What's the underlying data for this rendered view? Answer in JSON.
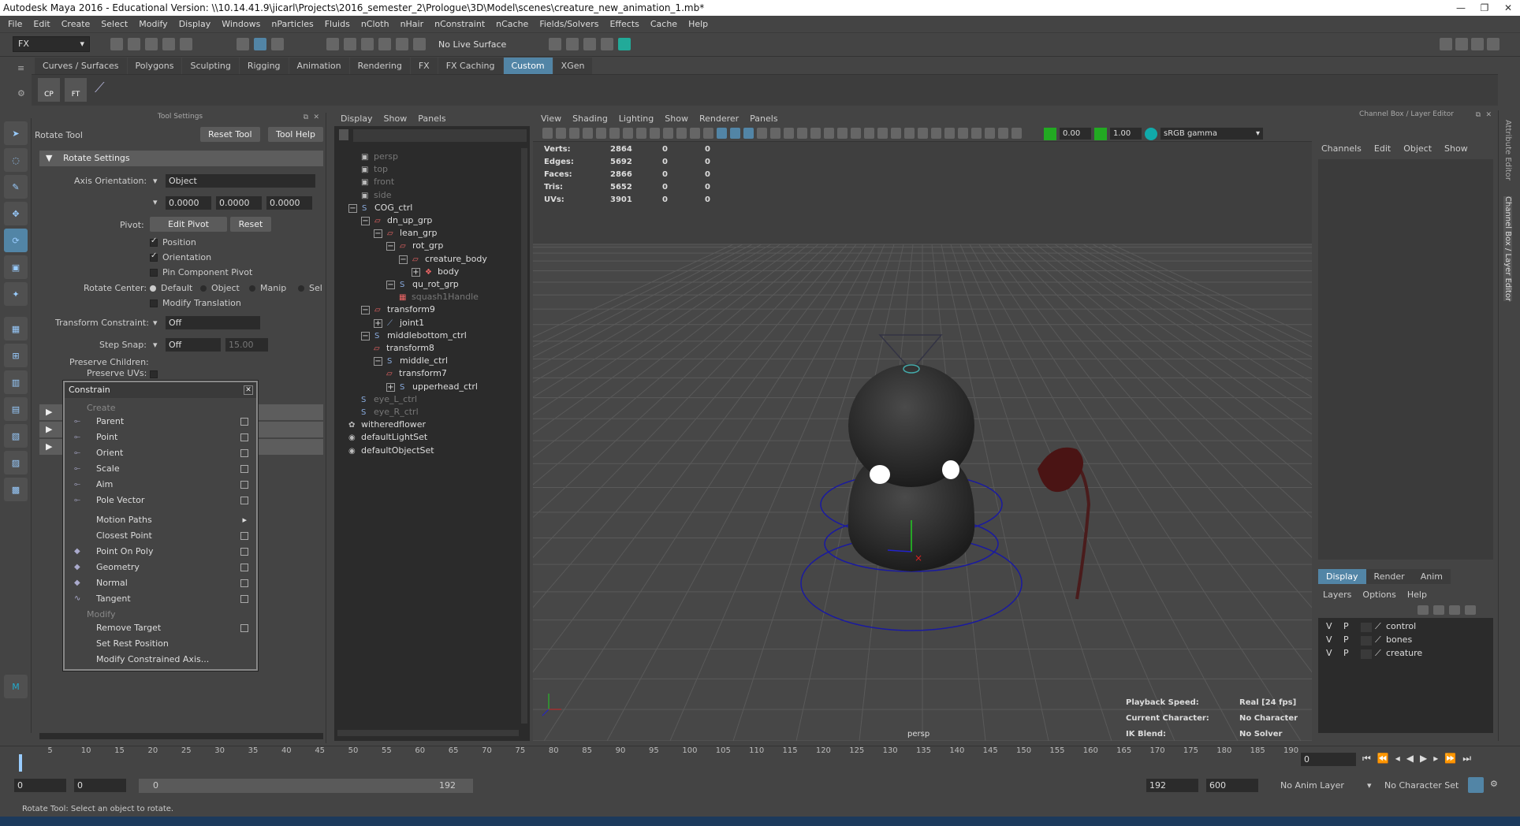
{
  "title": "Autodesk Maya 2016 - Educational Version: \\\\10.14.41.9\\jicarl\\Projects\\2016_semester_2\\Prologue\\3D\\Model\\scenes\\creature_new_animation_1.mb*",
  "menus": [
    "File",
    "Edit",
    "Create",
    "Select",
    "Modify",
    "Display",
    "Windows",
    "nParticles",
    "Fluids",
    "nCloth",
    "nHair",
    "nConstraint",
    "nCache",
    "Fields/Solvers",
    "Effects",
    "Cache",
    "Help"
  ],
  "status": {
    "menuset": "FX",
    "live_surface": "No Live Surface"
  },
  "shelf_tabs": [
    "Curves / Surfaces",
    "Polygons",
    "Sculpting",
    "Rigging",
    "Animation",
    "Rendering",
    "FX",
    "FX Caching",
    "Custom",
    "XGen"
  ],
  "shelf_buttons": [
    "CP",
    "FT"
  ],
  "tool_settings": {
    "header": "Tool Settings",
    "tool_name": "Rotate Tool",
    "reset_tool": "Reset Tool",
    "tool_help": "Tool Help",
    "section": "Rotate Settings",
    "axis_orientation_label": "Axis Orientation:",
    "axis_orientation_value": "Object",
    "axis_values": [
      "0.0000",
      "0.0000",
      "0.0000"
    ],
    "pivot_label": "Pivot:",
    "edit_pivot": "Edit Pivot",
    "reset": "Reset",
    "position": "Position",
    "orientation": "Orientation",
    "pin_component_pivot": "Pin Component Pivot",
    "rotate_center_label": "Rotate Center:",
    "rotate_center_options": [
      "Default",
      "Object",
      "Manip",
      "Sel"
    ],
    "modify_translation": "Modify Translation",
    "transform_constraint_label": "Transform Constraint:",
    "transform_constraint_value": "Off",
    "step_snap_label": "Step Snap:",
    "step_snap_value": "Off",
    "step_snap_amount": "15.00",
    "preserve_children": "Preserve Children:",
    "preserve_uvs": "Preserve UVs:"
  },
  "constrain_menu": {
    "title": "Constrain",
    "create_label": "Create",
    "modify_label": "Modify",
    "create_items": [
      "Parent",
      "Point",
      "Orient",
      "Scale",
      "Aim",
      "Pole Vector"
    ],
    "other_items": [
      "Motion Paths",
      "Closest Point",
      "Point On Poly",
      "Geometry",
      "Normal",
      "Tangent"
    ],
    "modify_items": [
      "Remove Target",
      "Set Rest Position",
      "Modify Constrained Axis..."
    ]
  },
  "outliner": {
    "menus": [
      "Display",
      "Show",
      "Panels"
    ],
    "items": [
      {
        "label": "persp",
        "dim": true
      },
      {
        "label": "top",
        "dim": true
      },
      {
        "label": "front",
        "dim": true
      },
      {
        "label": "side",
        "dim": true
      },
      {
        "label": "COG_ctrl",
        "dim": false
      },
      {
        "label": "dn_up_grp",
        "dim": false
      },
      {
        "label": "lean_grp",
        "dim": false
      },
      {
        "label": "rot_grp",
        "dim": false
      },
      {
        "label": "creature_body",
        "dim": false
      },
      {
        "label": "body",
        "dim": false
      },
      {
        "label": "qu_rot_grp",
        "dim": false
      },
      {
        "label": "squash1Handle",
        "dim": true
      },
      {
        "label": "transform9",
        "dim": false
      },
      {
        "label": "joint1",
        "dim": false
      },
      {
        "label": "middlebottom_ctrl",
        "dim": false
      },
      {
        "label": "transform8",
        "dim": false
      },
      {
        "label": "middle_ctrl",
        "dim": false
      },
      {
        "label": "transform7",
        "dim": false
      },
      {
        "label": "upperhead_ctrl",
        "dim": false
      },
      {
        "label": "eye_L_ctrl",
        "dim": true
      },
      {
        "label": "eye_R_ctrl",
        "dim": true
      },
      {
        "label": "witheredflower",
        "dim": false
      },
      {
        "label": "defaultLightSet",
        "dim": false
      },
      {
        "label": "defaultObjectSet",
        "dim": false
      }
    ]
  },
  "viewport": {
    "menus": [
      "View",
      "Shading",
      "Lighting",
      "Show",
      "Renderer",
      "Panels"
    ],
    "exposure": "0.00",
    "gamma": "1.00",
    "colorspace": "sRGB gamma",
    "stats": [
      {
        "label": "Verts:",
        "v1": "2864",
        "v2": "0",
        "v3": "0"
      },
      {
        "label": "Edges:",
        "v1": "5692",
        "v2": "0",
        "v3": "0"
      },
      {
        "label": "Faces:",
        "v1": "2866",
        "v2": "0",
        "v3": "0"
      },
      {
        "label": "Tris:",
        "v1": "5652",
        "v2": "0",
        "v3": "0"
      },
      {
        "label": "UVs:",
        "v1": "3901",
        "v2": "0",
        "v3": "0"
      }
    ],
    "camera": "persp",
    "playback_speed_label": "Playback Speed:",
    "playback_speed": "Real [24 fps]",
    "current_character_label": "Current Character:",
    "current_character": "No Character",
    "ik_blend_label": "IK Blend:",
    "ik_blend": "No Solver"
  },
  "channel_box": {
    "header": "Channel Box / Layer Editor",
    "menus": [
      "Channels",
      "Edit",
      "Object",
      "Show"
    ],
    "layer_tabs": [
      "Display",
      "Render",
      "Anim"
    ],
    "layer_menus": [
      "Layers",
      "Options",
      "Help"
    ],
    "layers": [
      {
        "v": "V",
        "p": "P",
        "name": "control"
      },
      {
        "v": "V",
        "p": "P",
        "name": "bones"
      },
      {
        "v": "V",
        "p": "P",
        "name": "creature"
      }
    ]
  },
  "timeline": {
    "ticks": [
      "5",
      "10",
      "15",
      "20",
      "25",
      "30",
      "35",
      "40",
      "45",
      "50",
      "55",
      "60",
      "65",
      "70",
      "75",
      "80",
      "85",
      "90",
      "95",
      "100",
      "105",
      "110",
      "115",
      "120",
      "125",
      "130",
      "135",
      "140",
      "145",
      "150",
      "155",
      "160",
      "165",
      "170",
      "175",
      "180",
      "185",
      "190"
    ],
    "current_frame": "0",
    "range_start": "0",
    "range_start2": "0",
    "range_inner_start": "0",
    "range_inner_end": "192",
    "range_end": "192",
    "range_end2": "600",
    "anim_layer": "No Anim Layer",
    "character_set": "No Character Set"
  },
  "help_line": "Rotate Tool: Select an object to rotate.",
  "right_tabs": [
    "Attribute Editor",
    "Channel Box / Layer Editor"
  ]
}
